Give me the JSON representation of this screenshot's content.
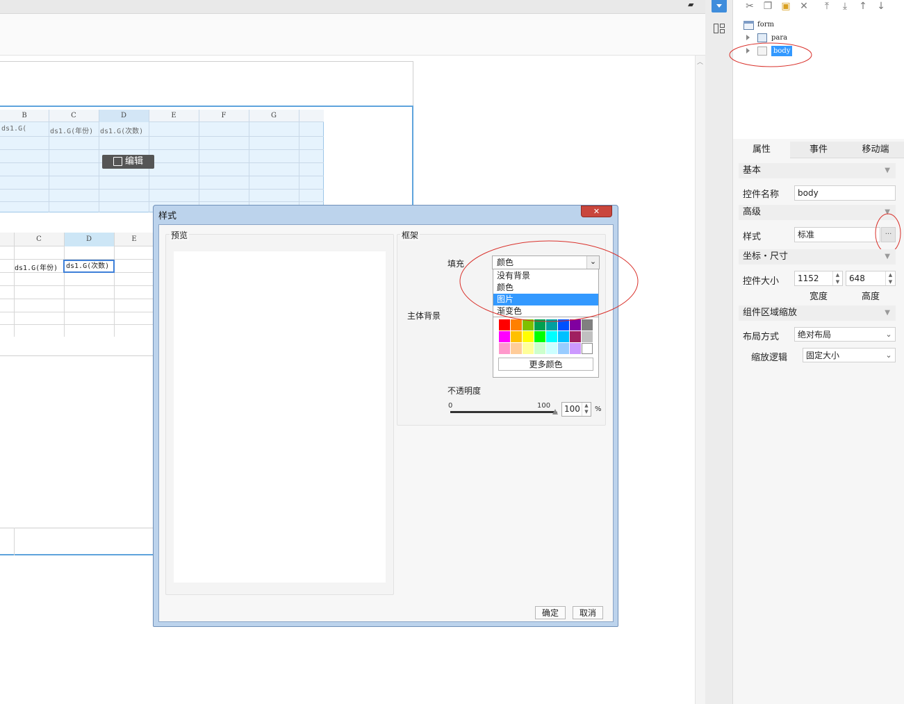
{
  "spreadsheet_top": {
    "columns": [
      "B",
      "C",
      "D",
      "E",
      "F",
      "G"
    ],
    "row1": [
      "ds1.G(",
      "ds1.G(年份)",
      "ds1.G(次数)"
    ],
    "edit_label": "编辑"
  },
  "spreadsheet_bottom": {
    "columns": [
      "C",
      "D",
      "E"
    ],
    "row1": [
      "ds1.G(年份)",
      "ds1.G(次数)"
    ]
  },
  "tree": {
    "items": [
      {
        "label": "form"
      },
      {
        "label": "para"
      },
      {
        "label": "body"
      }
    ]
  },
  "tabs": [
    {
      "label": "属性"
    },
    {
      "label": "事件"
    },
    {
      "label": "移动端"
    }
  ],
  "properties": {
    "section_basic": "基本",
    "name_label": "控件名称",
    "name_value": "body",
    "section_advanced": "高级",
    "style_label": "样式",
    "style_value": "标准",
    "style_btn": "···",
    "section_coords": "坐标・尺寸",
    "size_label": "控件大小",
    "width_value": "1152",
    "height_value": "648",
    "width_caption": "宽度",
    "height_caption": "高度",
    "section_zoom": "组件区域缩放",
    "layout_label": "布局方式",
    "layout_value": "绝对布局",
    "scale_label": "缩放逻辑",
    "scale_value": "固定大小"
  },
  "dialog": {
    "title": "样式",
    "close": "✕",
    "preview_label": "预览",
    "frame_label": "框架",
    "fill_label": "填充",
    "fill_value": "颜色",
    "fill_options": [
      "没有背景",
      "颜色",
      "图片",
      "渐变色"
    ],
    "fill_selected_index": 2,
    "body_bg_label": "主体背景",
    "more_colors": "更多颜色",
    "opacity_label": "不透明度",
    "slider_min": "0",
    "slider_max": "100",
    "opacity_value": "100",
    "opacity_unit": "%",
    "ok": "确定",
    "cancel": "取消"
  },
  "palette": [
    [
      "#ff0000",
      "#ff8000",
      "#80c000",
      "#00a050",
      "#00a0a0",
      "#0050ff",
      "#8000a0",
      "#808080"
    ],
    [
      "#ff00ff",
      "#ffc000",
      "#ffff00",
      "#00ff00",
      "#00ffff",
      "#00c0ff",
      "#a02060",
      "#c0c0c0"
    ],
    [
      "#ff99cc",
      "#ffcc99",
      "#ffff99",
      "#ccffcc",
      "#ccffff",
      "#99ccff",
      "#cc99ff",
      "#ffffff"
    ]
  ],
  "colors": {
    "accent": "#3399ff",
    "annotation": "#d9302a",
    "dialog_title_bg": "#bcd3ec",
    "close_button": "#c9463d"
  }
}
